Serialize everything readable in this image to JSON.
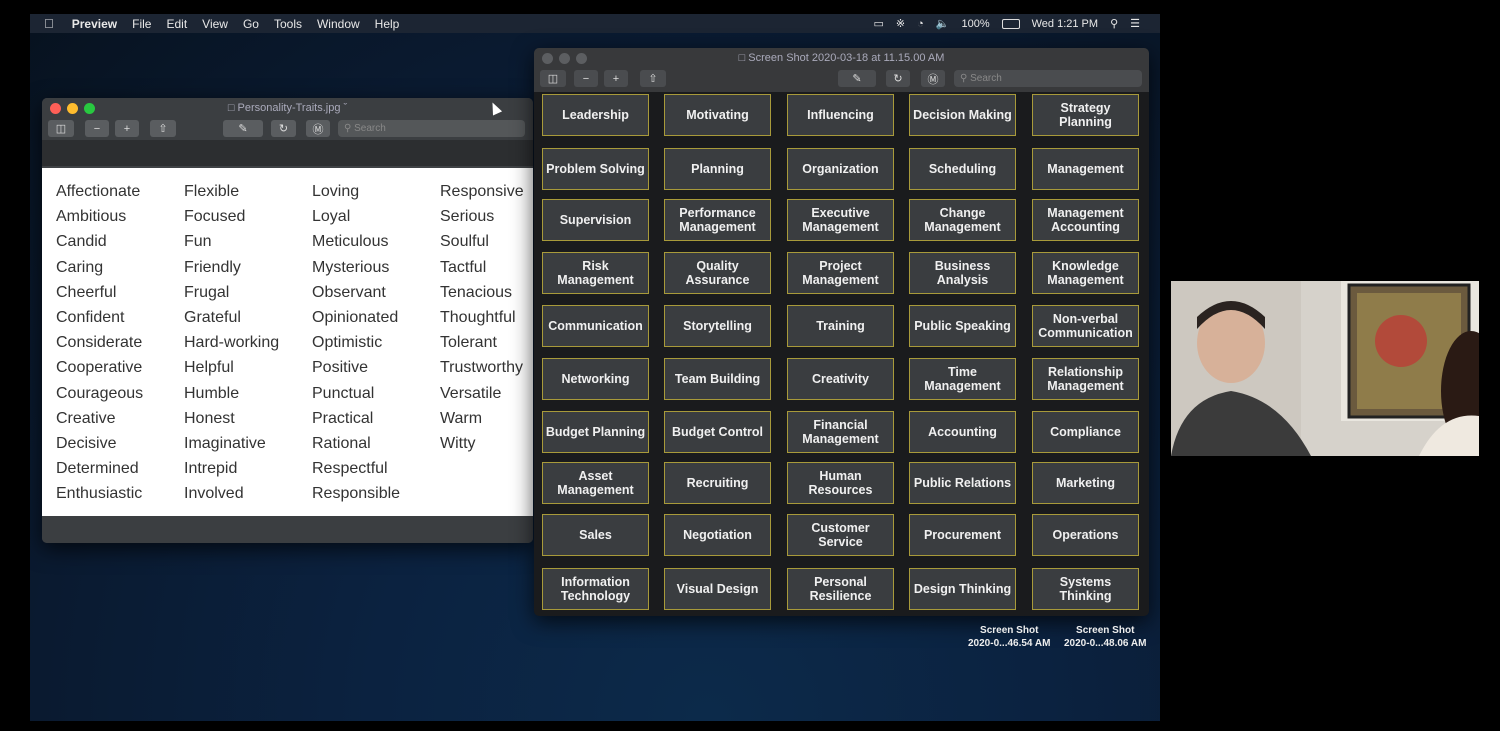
{
  "menubar": {
    "app_name": "Preview",
    "items": [
      "File",
      "Edit",
      "View",
      "Go",
      "Tools",
      "Window",
      "Help"
    ],
    "battery": "100%",
    "clock": "Wed 1:21 PM"
  },
  "personality_window": {
    "title": "Personality-Traits.jpg",
    "search_placeholder": "Search",
    "columns": [
      [
        "Affectionate",
        "Ambitious",
        "Candid",
        "Caring",
        "Cheerful",
        "Confident",
        "Considerate",
        "Cooperative",
        "Courageous",
        "Creative",
        "Decisive",
        "Determined",
        "Enthusiastic"
      ],
      [
        "Flexible",
        "Focused",
        "Fun",
        "Friendly",
        "Frugal",
        "Grateful",
        "Hard-working",
        "Helpful",
        "Humble",
        "Honest",
        "Imaginative",
        "Intrepid",
        "Involved"
      ],
      [
        "Loving",
        "Loyal",
        "Meticulous",
        "Mysterious",
        "Observant",
        "Opinionated",
        "Optimistic",
        "Positive",
        "Punctual",
        "Practical",
        "Rational",
        "Respectful",
        "Responsible"
      ],
      [
        "Responsive",
        "Serious",
        "Soulful",
        "Tactful",
        "Tenacious",
        "Thoughtful",
        "Tolerant",
        "Trustworthy",
        "Versatile",
        "Warm",
        "Witty"
      ]
    ]
  },
  "skills_window": {
    "title": "Screen Shot 2020-03-18 at 11.15.00 AM",
    "search_placeholder": "Search",
    "rows": [
      [
        "Leadership",
        "Motivating",
        "Influencing",
        "Decision Making",
        "Strategy Planning"
      ],
      [
        "Problem Solving",
        "Planning",
        "Organization",
        "Scheduling",
        "Management"
      ],
      [
        "Supervision",
        "Performance Management",
        "Executive Management",
        "Change Management",
        "Management Accounting"
      ],
      [
        "Risk Management",
        "Quality Assurance",
        "Project Management",
        "Business Analysis",
        "Knowledge Management"
      ],
      [
        "Communication",
        "Storytelling",
        "Training",
        "Public Speaking",
        "Non-verbal Communication"
      ],
      [
        "Networking",
        "Team Building",
        "Creativity",
        "Time Management",
        "Relationship Management"
      ],
      [
        "Budget Planning",
        "Budget Control",
        "Financial Management",
        "Accounting",
        "Compliance"
      ],
      [
        "Asset Management",
        "Recruiting",
        "Human Resources",
        "Public Relations",
        "Marketing"
      ],
      [
        "Sales",
        "Negotiation",
        "Customer Service",
        "Procurement",
        "Operations"
      ],
      [
        "Information Technology",
        "Visual Design",
        "Personal Resilience",
        "Design Thinking",
        "Systems Thinking"
      ]
    ]
  },
  "desktop_icons": [
    {
      "line1": "Screen Shot",
      "line2": "2020-0...46.54 AM"
    },
    {
      "line1": "Screen Shot",
      "line2": "2020-0...48.06 AM"
    }
  ],
  "colors": {
    "card_border": "#a89a3a",
    "close": "#fe5f57",
    "minimize": "#febc2e",
    "zoom": "#28c840"
  }
}
